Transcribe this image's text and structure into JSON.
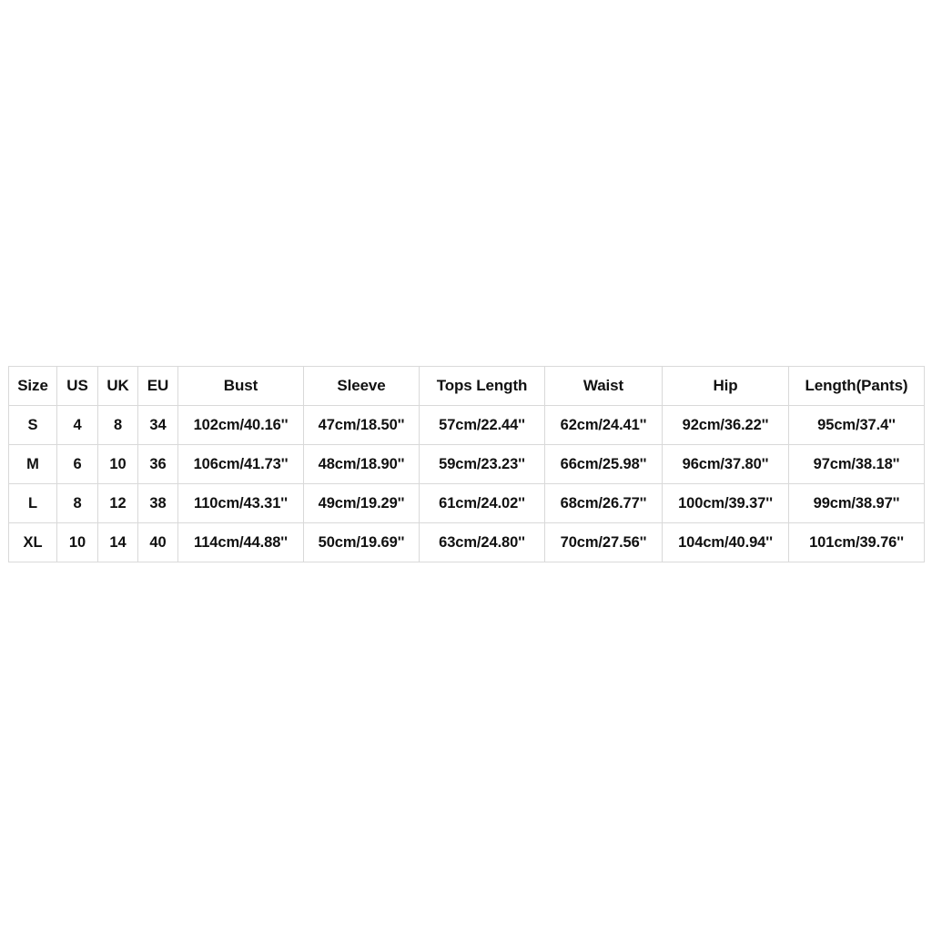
{
  "page": {
    "background_color": "#ffffff",
    "table_border_color": "#bdbdbd",
    "grid_line_color": "#d9d9d9",
    "text_color": "#111111"
  },
  "chart_data": {
    "type": "table",
    "title": "",
    "columns": [
      "Size",
      "US",
      "UK",
      "EU",
      "Bust",
      "Sleeve",
      "Tops Length",
      "Waist",
      "Hip",
      "Length(Pants)"
    ],
    "rows": [
      {
        "size": "S",
        "us": "4",
        "uk": "8",
        "eu": "34",
        "bust": "102cm/40.16''",
        "sleeve": "47cm/18.50''",
        "tops_length": "57cm/22.44''",
        "waist": "62cm/24.41''",
        "hip": "92cm/36.22''",
        "length_pants": "95cm/37.4''"
      },
      {
        "size": "M",
        "us": "6",
        "uk": "10",
        "eu": "36",
        "bust": "106cm/41.73''",
        "sleeve": "48cm/18.90''",
        "tops_length": "59cm/23.23''",
        "waist": "66cm/25.98''",
        "hip": "96cm/37.80''",
        "length_pants": "97cm/38.18''"
      },
      {
        "size": "L",
        "us": "8",
        "uk": "12",
        "eu": "38",
        "bust": "110cm/43.31''",
        "sleeve": "49cm/19.29''",
        "tops_length": "61cm/24.02''",
        "waist": "68cm/26.77''",
        "hip": "100cm/39.37''",
        "length_pants": "99cm/38.97''"
      },
      {
        "size": "XL",
        "us": "10",
        "uk": "14",
        "eu": "40",
        "bust": "114cm/44.88''",
        "sleeve": "50cm/19.69''",
        "tops_length": "63cm/24.80''",
        "waist": "70cm/27.56''",
        "hip": "104cm/40.94''",
        "length_pants": "101cm/39.76''"
      }
    ]
  }
}
